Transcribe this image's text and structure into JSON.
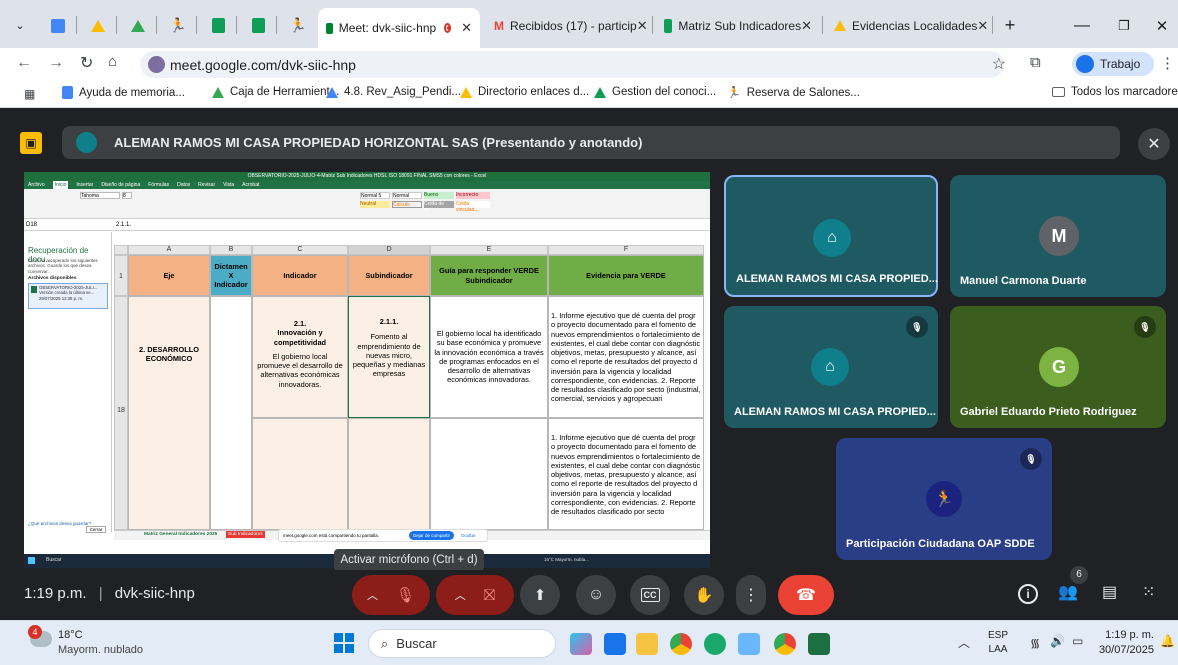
{
  "browser": {
    "tabs": [
      {
        "label": "Meet: dvk-siic-hnp"
      },
      {
        "label": "Recibidos (17) - particip"
      },
      {
        "label": "Matriz Sub Indicadores"
      },
      {
        "label": "Evidencias Localidades"
      }
    ],
    "url": "meet.google.com/dvk-siic-hnp",
    "profile": "Trabajo",
    "bookmarks": [
      "Ayuda de memoria...",
      "Caja de Herramient...",
      "4.8. Rev_Asig_Pendi...",
      "Directorio enlaces d...",
      "Gestion del conoci...",
      "Reserva de Salones..."
    ],
    "all_bookmarks": "Todos los marcadores"
  },
  "meet": {
    "presenting_banner": "ALEMAN RAMOS MI CASA PROPIEDAD HORIZONTAL SAS (Presentando y anotando)",
    "participants": [
      {
        "name": "ALEMAN RAMOS MI CASA PROPIED...",
        "initial": "",
        "muted": false,
        "active": true
      },
      {
        "name": "Manuel Carmona Duarte",
        "initial": "M",
        "muted": false,
        "active": false
      },
      {
        "name": "ALEMAN RAMOS MI CASA PROPIED...",
        "initial": "",
        "muted": true,
        "active": false
      },
      {
        "name": "Gabriel Eduardo Prieto Rodriguez",
        "initial": "G",
        "muted": true,
        "active": false
      },
      {
        "name": "Participación Ciudadana OAP SDDE",
        "initial": "",
        "muted": true,
        "active": false
      }
    ],
    "time": "1:19 p.m.",
    "code": "dvk-siic-hnp",
    "tooltip": "Activar micrófono (Ctrl + d)",
    "people_count": "6"
  },
  "excel": {
    "title": "OBSERVATORIO-2025-JULIO-4-Matriz Sub Indicadores HDSL ISO 18091 FINAL SMS5 con colores - Excel",
    "menu": [
      "Archivo",
      "Inicio",
      "Insertar",
      "Diseño de página",
      "Fórmulas",
      "Datos",
      "Revisar",
      "Vista",
      "Acrobat"
    ],
    "font": "Tahoma",
    "font_size": "8",
    "cell_ref": "D18",
    "formula": "2.1.1.",
    "recovery_title": "Recuperación de docu...",
    "recovery_text": "Excel ha recuperado los siguientes archivos. Guarde los que desea conservar.",
    "recovery_files": "Archivos disponibles",
    "recovery_item": "OBSERVATORIO-2025-JULI... Versión creada la última ve... 29/07/2025 12:38 p. m.",
    "recovery_question": "¿Qué archivos desea guardar?",
    "close": "Cerrar",
    "columns": [
      "A",
      "B",
      "C",
      "D",
      "E",
      "F"
    ],
    "headers": [
      "Eje",
      "Dictamen X Indicador",
      "Indicador",
      "Subindicador",
      "Guía para responder VERDE Subindicador",
      "Evidencia para VERDE"
    ],
    "rows": [
      "1",
      "18"
    ],
    "eje": "2. DESARROLLO ECONÓMICO",
    "indicador_code": "2.1.",
    "indicador_title": "Innovación y competitividad",
    "indicador_desc": "El gobierno local promueve el desarrollo de alternativas económicas innovadoras.",
    "sub_code": "2.1.1.",
    "sub_desc": "Fomento al emprendimiento de nuevas micro, pequeñas y medianas empresas",
    "guia": "El gobierno local ha identificado su base económica y promueve la innovación económica a través de programas enfocados en el desarrollo de alternativas económicas innovadoras.",
    "evidencia": "1. Informe ejecutivo que dé cuenta del progr o proyecto documentado para el fomento de nuevos emprendimientos o fortalecimiento de existentes, el cual debe contar con diagnóstic objetivos, metas, presupuesto y alcance, así como el reporte de resultados del proyecto d inversión para la vigencia y localidad correspondiente, con evidencias. 2. Reporte de resultados clasificado por secto (industrial, comercial, servicios y agropecuari",
    "evidencia2": "1. Informe ejecutivo que dé cuenta del progr o proyecto documentado para el fomento de nuevos emprendimientos o fortalecimiento de existentes, el cual debe contar con diagnóstic objetivos, metas, presupuesto y alcance, así como el reporte de resultados del proyecto d inversión para la vigencia y localidad correspondiente, con evidencias. 2. Reporte de resultados clasificado por secto",
    "sheet_tabs": [
      "Matriz General Indicadores 2025",
      "Sub Indicadores"
    ],
    "sharing": "meet.google.com está compartiendo tu pantalla.",
    "stop_sharing": "Dejar de compartir",
    "hide": "Ocultar",
    "search": "Buscar",
    "weather": "16°C  Mayorm. nubla...",
    "styles": [
      "Normal 5",
      "Normal",
      "Bueno",
      "Incorrecto",
      "Neutral",
      "Cálculo",
      "Celda de co...",
      "Celda vinculad..."
    ]
  },
  "taskbar": {
    "weather_temp": "18°C",
    "weather_desc": "Mayorm. nublado",
    "search": "Buscar",
    "lang1": "ESP",
    "lang2": "LAA",
    "time": "1:19 p. m.",
    "date": "30/07/2025",
    "badge": "4"
  },
  "colors": {
    "accent": "#8ab4f8",
    "tile_teal": "#1f5a62",
    "avatar_teal": "#0f7f8c",
    "end_call": "#ea4335",
    "header_orange": "#f4b183",
    "header_green": "#70ad47",
    "header_blue": "#4bacc6"
  }
}
